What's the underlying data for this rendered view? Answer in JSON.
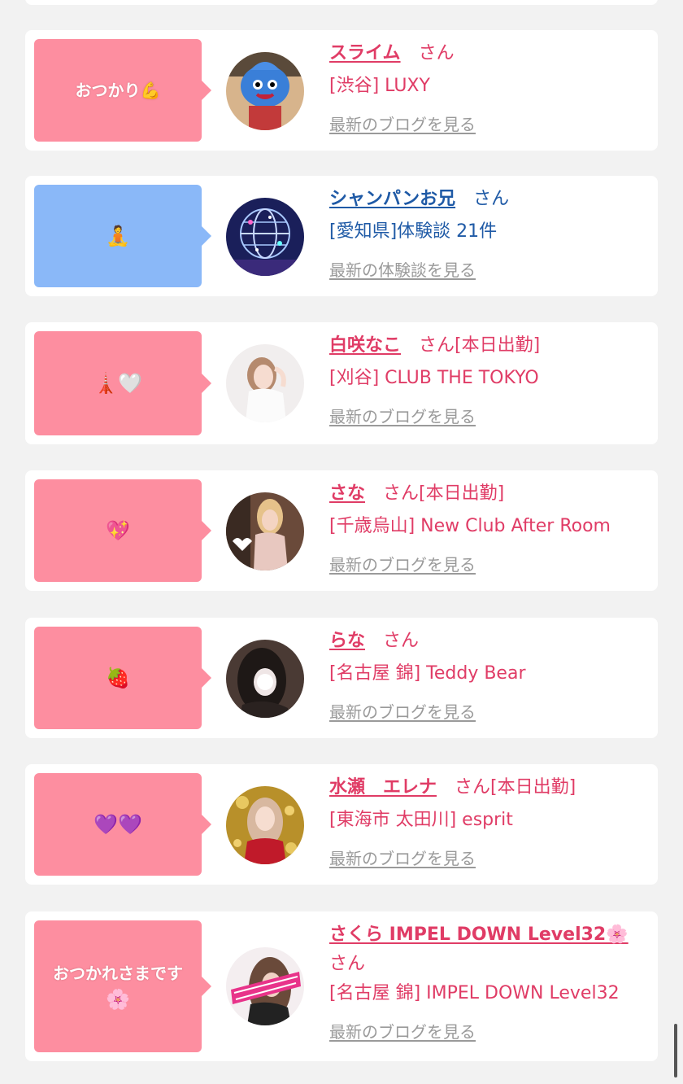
{
  "feed": [
    {
      "bubble_lines": [
        "おつかり💪"
      ],
      "bubble_color": "#fd8ea0",
      "name": "スライム",
      "honorific": "さん",
      "status": "",
      "shop": "[渋谷] LUXY",
      "link": "最新のブログを見る",
      "text_color": "#e03c66",
      "avatar": "blue-slime-costume"
    },
    {
      "bubble_lines": [
        "🧘"
      ],
      "bubble_color": "#8ab8f8",
      "name": "シャンパンお兄",
      "honorific": "さん",
      "status": "",
      "shop": "[愛知県]体験談 21件",
      "link": "最新の体験談を見る",
      "text_color": "#1f5aa6",
      "avatar": "champagne-tower-globe"
    },
    {
      "bubble_lines": [
        "🗼🤍"
      ],
      "bubble_color": "#fd8ea0",
      "name": "白咲なこ",
      "honorific": "さん",
      "status": "[本日出勤]",
      "shop": "[刈谷] CLUB THE TOKYO",
      "link": "最新のブログを見る",
      "text_color": "#e03c66",
      "avatar": "woman-white-dress"
    },
    {
      "bubble_lines": [
        "💖"
      ],
      "bubble_color": "#fd8ea0",
      "name": "さな",
      "honorific": "さん",
      "status": "[本日出勤]",
      "shop": "[千歳烏山] New Club After Room",
      "link": "最新のブログを見る",
      "text_color": "#e03c66",
      "avatar": "woman-mirror-selfie"
    },
    {
      "bubble_lines": [
        "🍓"
      ],
      "bubble_color": "#fd8ea0",
      "name": "らな",
      "honorific": "さん",
      "status": "",
      "shop": "[名古屋 錦] Teddy Bear",
      "link": "最新のブログを見る",
      "text_color": "#e03c66",
      "avatar": "woman-dark-hair-blurred"
    },
    {
      "bubble_lines": [
        "💜💜"
      ],
      "bubble_color": "#fd8ea0",
      "name": "水瀬　エレナ",
      "honorific": "さん",
      "status": "[本日出勤]",
      "shop": "[東海市 太田川] esprit",
      "link": "最新のブログを見る",
      "text_color": "#e03c66",
      "avatar": "woman-gold-background"
    },
    {
      "bubble_lines": [
        "おつかれさまです",
        "🌸"
      ],
      "bubble_color": "#fd8ea0",
      "name": "さくら IMPEL DOWN Level32🌸",
      "honorific": "さん",
      "status": "",
      "shop": "[名古屋 錦] IMPEL DOWN Level32",
      "link": "最新のブログを見る",
      "text_color": "#e03c66",
      "avatar": "woman-pink-sash"
    }
  ]
}
